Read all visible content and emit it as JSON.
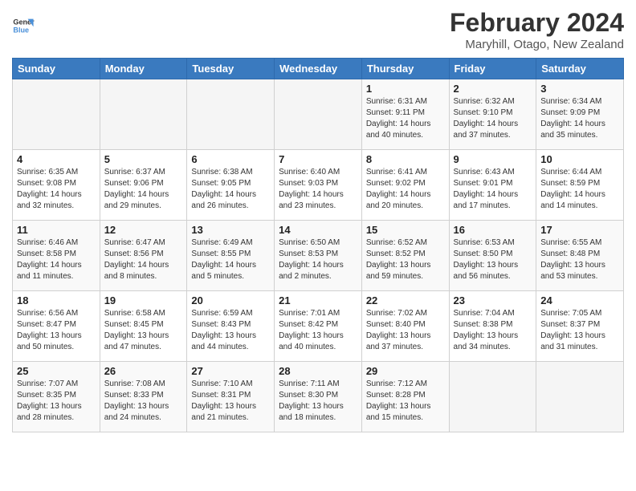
{
  "header": {
    "logo_general": "General",
    "logo_blue": "Blue",
    "title": "February 2024",
    "subtitle": "Maryhill, Otago, New Zealand"
  },
  "days_of_week": [
    "Sunday",
    "Monday",
    "Tuesday",
    "Wednesday",
    "Thursday",
    "Friday",
    "Saturday"
  ],
  "weeks": [
    [
      {
        "day": "",
        "info": ""
      },
      {
        "day": "",
        "info": ""
      },
      {
        "day": "",
        "info": ""
      },
      {
        "day": "",
        "info": ""
      },
      {
        "day": "1",
        "info": "Sunrise: 6:31 AM\nSunset: 9:11 PM\nDaylight: 14 hours\nand 40 minutes."
      },
      {
        "day": "2",
        "info": "Sunrise: 6:32 AM\nSunset: 9:10 PM\nDaylight: 14 hours\nand 37 minutes."
      },
      {
        "day": "3",
        "info": "Sunrise: 6:34 AM\nSunset: 9:09 PM\nDaylight: 14 hours\nand 35 minutes."
      }
    ],
    [
      {
        "day": "4",
        "info": "Sunrise: 6:35 AM\nSunset: 9:08 PM\nDaylight: 14 hours\nand 32 minutes."
      },
      {
        "day": "5",
        "info": "Sunrise: 6:37 AM\nSunset: 9:06 PM\nDaylight: 14 hours\nand 29 minutes."
      },
      {
        "day": "6",
        "info": "Sunrise: 6:38 AM\nSunset: 9:05 PM\nDaylight: 14 hours\nand 26 minutes."
      },
      {
        "day": "7",
        "info": "Sunrise: 6:40 AM\nSunset: 9:03 PM\nDaylight: 14 hours\nand 23 minutes."
      },
      {
        "day": "8",
        "info": "Sunrise: 6:41 AM\nSunset: 9:02 PM\nDaylight: 14 hours\nand 20 minutes."
      },
      {
        "day": "9",
        "info": "Sunrise: 6:43 AM\nSunset: 9:01 PM\nDaylight: 14 hours\nand 17 minutes."
      },
      {
        "day": "10",
        "info": "Sunrise: 6:44 AM\nSunset: 8:59 PM\nDaylight: 14 hours\nand 14 minutes."
      }
    ],
    [
      {
        "day": "11",
        "info": "Sunrise: 6:46 AM\nSunset: 8:58 PM\nDaylight: 14 hours\nand 11 minutes."
      },
      {
        "day": "12",
        "info": "Sunrise: 6:47 AM\nSunset: 8:56 PM\nDaylight: 14 hours\nand 8 minutes."
      },
      {
        "day": "13",
        "info": "Sunrise: 6:49 AM\nSunset: 8:55 PM\nDaylight: 14 hours\nand 5 minutes."
      },
      {
        "day": "14",
        "info": "Sunrise: 6:50 AM\nSunset: 8:53 PM\nDaylight: 14 hours\nand 2 minutes."
      },
      {
        "day": "15",
        "info": "Sunrise: 6:52 AM\nSunset: 8:52 PM\nDaylight: 13 hours\nand 59 minutes."
      },
      {
        "day": "16",
        "info": "Sunrise: 6:53 AM\nSunset: 8:50 PM\nDaylight: 13 hours\nand 56 minutes."
      },
      {
        "day": "17",
        "info": "Sunrise: 6:55 AM\nSunset: 8:48 PM\nDaylight: 13 hours\nand 53 minutes."
      }
    ],
    [
      {
        "day": "18",
        "info": "Sunrise: 6:56 AM\nSunset: 8:47 PM\nDaylight: 13 hours\nand 50 minutes."
      },
      {
        "day": "19",
        "info": "Sunrise: 6:58 AM\nSunset: 8:45 PM\nDaylight: 13 hours\nand 47 minutes."
      },
      {
        "day": "20",
        "info": "Sunrise: 6:59 AM\nSunset: 8:43 PM\nDaylight: 13 hours\nand 44 minutes."
      },
      {
        "day": "21",
        "info": "Sunrise: 7:01 AM\nSunset: 8:42 PM\nDaylight: 13 hours\nand 40 minutes."
      },
      {
        "day": "22",
        "info": "Sunrise: 7:02 AM\nSunset: 8:40 PM\nDaylight: 13 hours\nand 37 minutes."
      },
      {
        "day": "23",
        "info": "Sunrise: 7:04 AM\nSunset: 8:38 PM\nDaylight: 13 hours\nand 34 minutes."
      },
      {
        "day": "24",
        "info": "Sunrise: 7:05 AM\nSunset: 8:37 PM\nDaylight: 13 hours\nand 31 minutes."
      }
    ],
    [
      {
        "day": "25",
        "info": "Sunrise: 7:07 AM\nSunset: 8:35 PM\nDaylight: 13 hours\nand 28 minutes."
      },
      {
        "day": "26",
        "info": "Sunrise: 7:08 AM\nSunset: 8:33 PM\nDaylight: 13 hours\nand 24 minutes."
      },
      {
        "day": "27",
        "info": "Sunrise: 7:10 AM\nSunset: 8:31 PM\nDaylight: 13 hours\nand 21 minutes."
      },
      {
        "day": "28",
        "info": "Sunrise: 7:11 AM\nSunset: 8:30 PM\nDaylight: 13 hours\nand 18 minutes."
      },
      {
        "day": "29",
        "info": "Sunrise: 7:12 AM\nSunset: 8:28 PM\nDaylight: 13 hours\nand 15 minutes."
      },
      {
        "day": "",
        "info": ""
      },
      {
        "day": "",
        "info": ""
      }
    ]
  ]
}
